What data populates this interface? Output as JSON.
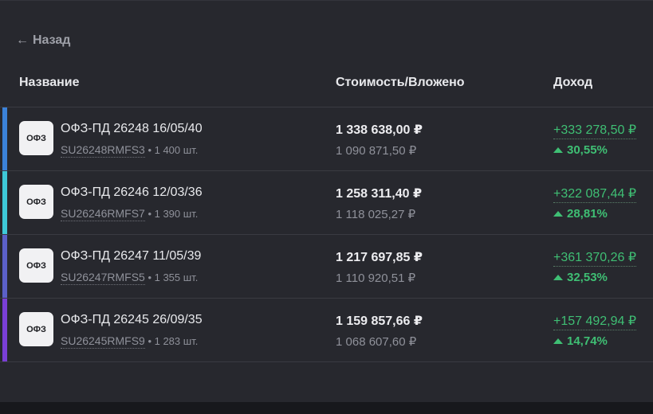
{
  "nav": {
    "back_label": "Назад",
    "back_icon": "arrow-left-icon"
  },
  "columns": {
    "name": "Название",
    "value": "Стоимость/Вложено",
    "income": "Доход"
  },
  "rows": [
    {
      "logo_text": "ОФЗ",
      "title": "ОФЗ-ПД 26248 16/05/40",
      "ticker": "SU26248RMFS3",
      "qty": " • 1 400 шт.",
      "value": "1 338 638,00 ₽",
      "invested": "1 090 871,50 ₽",
      "income": "+333 278,50 ₽",
      "pct": "30,55%",
      "color": "#3b82d9"
    },
    {
      "logo_text": "ОФЗ",
      "title": "ОФЗ-ПД 26246 12/03/36",
      "ticker": "SU26246RMFS7",
      "qty": " • 1 390 шт.",
      "value": "1 258 311,40 ₽",
      "invested": "1 118 025,27 ₽",
      "income": "+322 087,44 ₽",
      "pct": "28,81%",
      "color": "#3ec9d8"
    },
    {
      "logo_text": "ОФЗ",
      "title": "ОФЗ-ПД 26247 11/05/39",
      "ticker": "SU26247RMFS5",
      "qty": " • 1 355 шт.",
      "value": "1 217 697,85 ₽",
      "invested": "1 110 920,51 ₽",
      "income": "+361 370,26 ₽",
      "pct": "32,53%",
      "color": "#5b60c8"
    },
    {
      "logo_text": "ОФЗ",
      "title": "ОФЗ-ПД 26245 26/09/35",
      "ticker": "SU26245RMFS9",
      "qty": " • 1 283 шт.",
      "value": "1 159 857,66 ₽",
      "invested": "1 068 607,60 ₽",
      "income": "+157 492,94 ₽",
      "pct": "14,74%",
      "color": "#7a3fd6"
    }
  ],
  "colors": {
    "positive": "#3fbf74",
    "panel_bg": "#27282e",
    "page_bg": "#17181c"
  }
}
